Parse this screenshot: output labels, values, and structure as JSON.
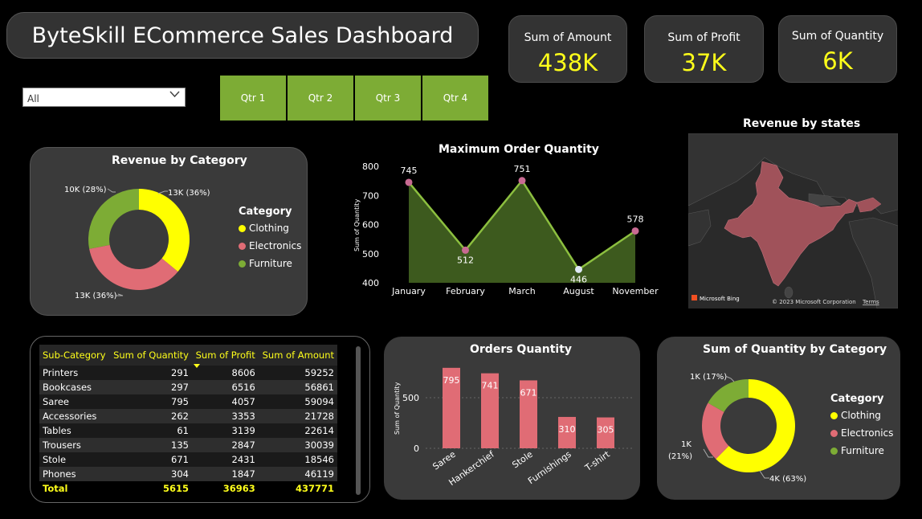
{
  "header": {
    "title": "ByteSkill ECommerce Sales Dashboard"
  },
  "kpis": [
    {
      "label": "Sum of Amount",
      "value": "438K"
    },
    {
      "label": "Sum of Profit",
      "value": "37K"
    },
    {
      "label": "Sum of Quantity",
      "value": "6K"
    }
  ],
  "filter": {
    "selected": "All"
  },
  "quarters": [
    "Qtr 1",
    "Qtr 2",
    "Qtr 3",
    "Qtr 4"
  ],
  "colors": {
    "clothing": "#ffff00",
    "electronics": "#e06c75",
    "furniture": "#7dac35",
    "accent": "#ffff1a",
    "slicer": "#7dac35"
  },
  "revenue_by_category": {
    "title": "Revenue by Category",
    "legend_title": "Category",
    "labels": {
      "clothing": "13K (36%)",
      "electronics": "13K (36%)",
      "furniture": "10K (28%)"
    }
  },
  "max_order_qty": {
    "title": "Maximum Order Quantity",
    "ylabel": "Sum of Quantity"
  },
  "map": {
    "title": "Revenue by states",
    "brand": "Microsoft Bing",
    "copyright": "© 2023 Microsoft Corporation",
    "terms": "Terms"
  },
  "table": {
    "headers": [
      "Sub-Category",
      "Sum of Quantity",
      "Sum of Profit",
      "Sum of Amount"
    ],
    "rows": [
      [
        "Printers",
        "291",
        "8606",
        "59252"
      ],
      [
        "Bookcases",
        "297",
        "6516",
        "56861"
      ],
      [
        "Saree",
        "795",
        "4057",
        "59094"
      ],
      [
        "Accessories",
        "262",
        "3353",
        "21728"
      ],
      [
        "Tables",
        "61",
        "3139",
        "22614"
      ],
      [
        "Trousers",
        "135",
        "2847",
        "30039"
      ],
      [
        "Stole",
        "671",
        "2431",
        "18546"
      ],
      [
        "Phones",
        "304",
        "1847",
        "46119"
      ]
    ],
    "total": [
      "Total",
      "5615",
      "36963",
      "437771"
    ]
  },
  "orders_qty": {
    "title": "Orders Quantity",
    "ylabel": "Sum of Quantity"
  },
  "qty_by_category": {
    "title": "Sum of Quantity by Category",
    "legend_title": "Category",
    "labels": {
      "clothing": "4K (63%)",
      "electronics_1": "1K",
      "electronics_2": "(21%)",
      "furniture": "1K (17%)"
    }
  },
  "legend_items": [
    "Clothing",
    "Electronics",
    "Furniture"
  ],
  "chart_data": [
    {
      "type": "pie",
      "title": "Revenue by Category",
      "categories": [
        "Clothing",
        "Electronics",
        "Furniture"
      ],
      "values": [
        36,
        36,
        28
      ],
      "labels": [
        "13K (36%)",
        "13K (36%)",
        "10K (28%)"
      ]
    },
    {
      "type": "area",
      "title": "Maximum Order Quantity",
      "categories": [
        "January",
        "February",
        "March",
        "August",
        "November"
      ],
      "values": [
        745,
        512,
        751,
        446,
        578
      ],
      "ylabel": "Sum of Quantity",
      "yticks": [
        "400",
        "500",
        "600",
        "700",
        "800"
      ],
      "ylim": [
        400,
        800
      ]
    },
    {
      "type": "bar",
      "title": "Orders Quantity",
      "categories": [
        "Saree",
        "Hankerchief",
        "Stole",
        "Furnishings",
        "T-shirt"
      ],
      "values": [
        795,
        741,
        671,
        310,
        305
      ],
      "ylabel": "Sum of Quantity",
      "yticks": [
        "0",
        "500"
      ],
      "ylim": [
        0,
        800
      ]
    },
    {
      "type": "pie",
      "title": "Sum of Quantity by Category",
      "categories": [
        "Clothing",
        "Electronics",
        "Furniture"
      ],
      "values": [
        63,
        21,
        17
      ]
    }
  ]
}
